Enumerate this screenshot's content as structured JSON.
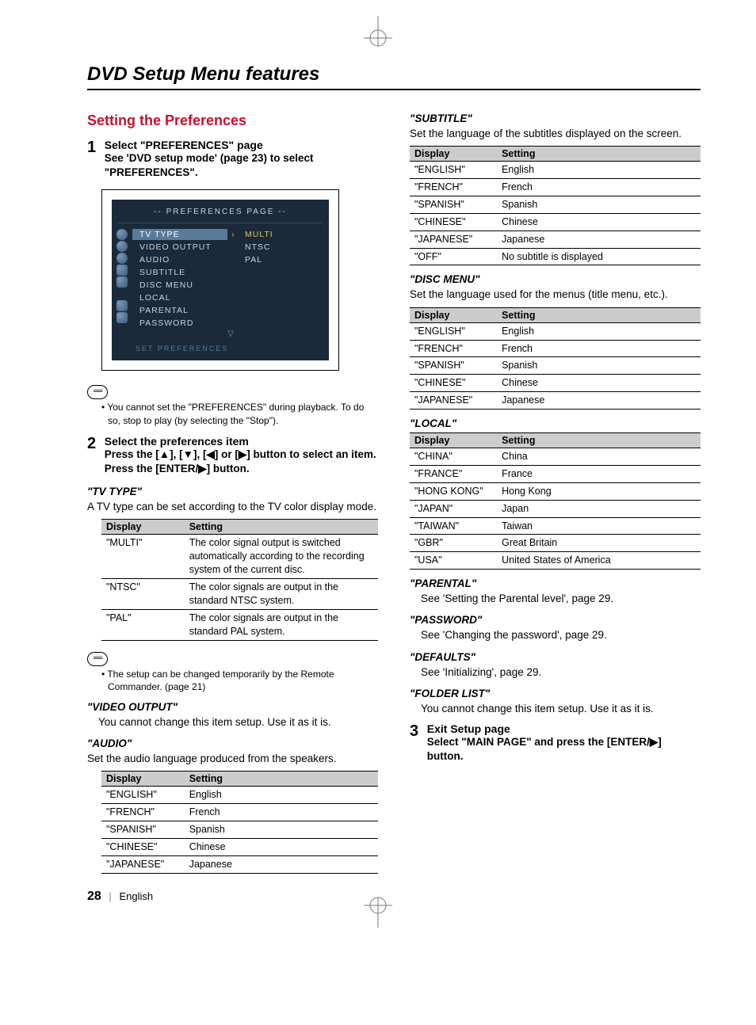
{
  "doc_title": "DVD Setup Menu features",
  "section_title": "Setting the Preferences",
  "steps": {
    "s1": {
      "num": "1",
      "title": "Select \"PREFERENCES\" page",
      "text": "See 'DVD setup mode' (page 23) to select \"PREFERENCES\"."
    },
    "s2": {
      "num": "2",
      "title": "Select the preferences item",
      "text1": "Press the [▲], [▼], [◀] or [▶] button to select an item.",
      "text2": "Press the [ENTER/▶] button."
    },
    "s3": {
      "num": "3",
      "title": "Exit Setup page",
      "text": "Select \"MAIN PAGE\" and press the [ENTER/▶] button."
    }
  },
  "osd": {
    "title": "-- PREFERENCES PAGE --",
    "items": [
      "TV TYPE",
      "VIDEO OUTPUT",
      "AUDIO",
      "SUBTITLE",
      "DISC MENU",
      "LOCAL",
      "PARENTAL",
      "PASSWORD"
    ],
    "opts": [
      "MULTI",
      "NTSC",
      "PAL"
    ],
    "footer": "SET PREFERENCES"
  },
  "notes": {
    "n1": "You cannot set the \"PREFERENCES\" during playback. To do so, stop to play (by selecting the \"Stop\").",
    "n2": "The setup can be changed temporarily by the Remote Commander. (page 21)"
  },
  "tvtype": {
    "heading": "\"TV TYPE\"",
    "desc": "A TV type can be set according to the TV color display mode.",
    "head": {
      "c1": "Display",
      "c2": "Setting"
    },
    "rows": [
      {
        "d": "\"MULTI\"",
        "s": "The color signal output is switched automatically according to the recording system of the current disc."
      },
      {
        "d": "\"NTSC\"",
        "s": "The color signals are output in the standard NTSC system."
      },
      {
        "d": "\"PAL\"",
        "s": "The color signals are output in the standard PAL system."
      }
    ]
  },
  "video_output": {
    "heading": "\"VIDEO OUTPUT\"",
    "desc": "You cannot change this item setup. Use it as it is."
  },
  "audio": {
    "heading": "\"AUDIO\"",
    "desc": "Set the audio language produced from the speakers.",
    "head": {
      "c1": "Display",
      "c2": "Setting"
    },
    "rows": [
      {
        "d": "\"ENGLISH\"",
        "s": "English"
      },
      {
        "d": "\"FRENCH\"",
        "s": "French"
      },
      {
        "d": "\"SPANISH\"",
        "s": "Spanish"
      },
      {
        "d": "\"CHINESE\"",
        "s": "Chinese"
      },
      {
        "d": "\"JAPANESE\"",
        "s": "Japanese"
      }
    ]
  },
  "subtitle": {
    "heading": "\"SUBTITLE\"",
    "desc": "Set the language of the subtitles displayed on the screen.",
    "head": {
      "c1": "Display",
      "c2": "Setting"
    },
    "rows": [
      {
        "d": "\"ENGLISH\"",
        "s": "English"
      },
      {
        "d": "\"FRENCH\"",
        "s": "French"
      },
      {
        "d": "\"SPANISH\"",
        "s": "Spanish"
      },
      {
        "d": "\"CHINESE\"",
        "s": "Chinese"
      },
      {
        "d": "\"JAPANESE\"",
        "s": "Japanese"
      },
      {
        "d": "\"OFF\"",
        "s": "No subtitle is displayed"
      }
    ]
  },
  "discmenu": {
    "heading": "\"DISC MENU\"",
    "desc": "Set the language used for the menus (title menu, etc.).",
    "head": {
      "c1": "Display",
      "c2": "Setting"
    },
    "rows": [
      {
        "d": "\"ENGLISH\"",
        "s": "English"
      },
      {
        "d": "\"FRENCH\"",
        "s": "French"
      },
      {
        "d": "\"SPANISH\"",
        "s": "Spanish"
      },
      {
        "d": "\"CHINESE\"",
        "s": "Chinese"
      },
      {
        "d": "\"JAPANESE\"",
        "s": "Japanese"
      }
    ]
  },
  "local": {
    "heading": "\"LOCAL\"",
    "head": {
      "c1": "Display",
      "c2": "Setting"
    },
    "rows": [
      {
        "d": "\"CHINA\"",
        "s": "China"
      },
      {
        "d": "\"FRANCE\"",
        "s": "France"
      },
      {
        "d": "\"HONG KONG\"",
        "s": "Hong Kong"
      },
      {
        "d": "\"JAPAN\"",
        "s": "Japan"
      },
      {
        "d": "\"TAIWAN\"",
        "s": "Taiwan"
      },
      {
        "d": "\"GBR\"",
        "s": "Great Britain"
      },
      {
        "d": "\"USA\"",
        "s": "United States of America"
      }
    ]
  },
  "parental": {
    "heading": "\"PARENTAL\"",
    "desc": "See 'Setting the Parental level', page 29."
  },
  "password": {
    "heading": "\"PASSWORD\"",
    "desc": "See 'Changing the password', page 29."
  },
  "defaults": {
    "heading": "\"DEFAULTS\"",
    "desc": "See 'Initializing', page 29."
  },
  "folderlist": {
    "heading": "\"FOLDER LIST\"",
    "desc": "You cannot change this item setup. Use it as it is."
  },
  "footer": {
    "page": "28",
    "lang": "English"
  }
}
